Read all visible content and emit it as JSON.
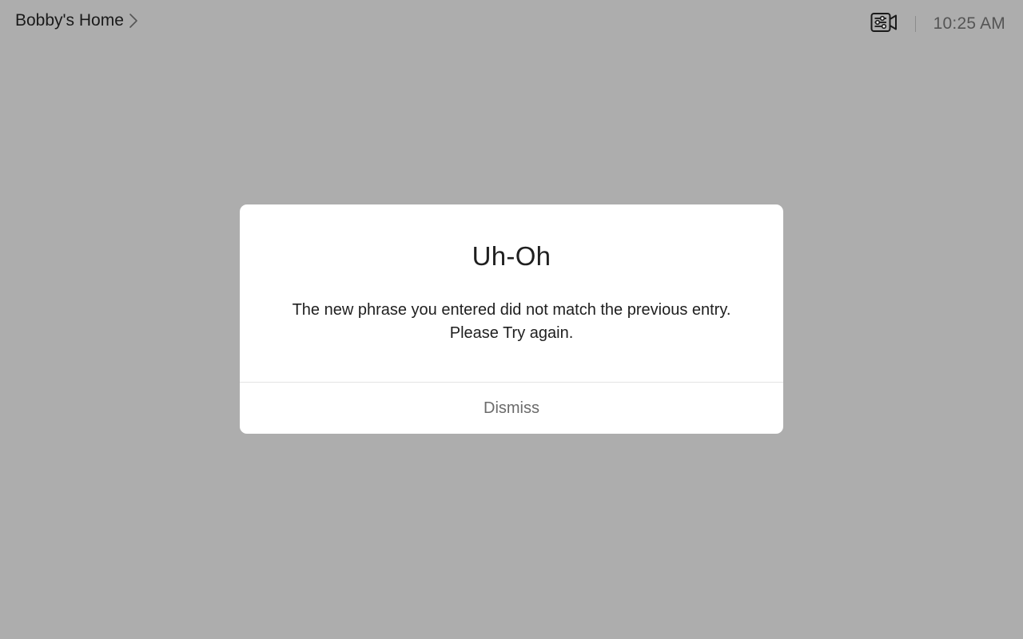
{
  "header": {
    "location_label": "Bobby's Home",
    "chevron_icon": "chevron-right-icon",
    "camera_controls_icon": "camera-controls-icon",
    "time": "10:25 AM"
  },
  "dialog": {
    "title": "Uh-Oh",
    "message": "The new phrase you entered did not match the previous entry. Please Try again.",
    "dismiss_label": "Dismiss"
  },
  "colors": {
    "backdrop": "#adadad",
    "dialog_bg": "#ffffff",
    "text_primary": "#1f1f1f",
    "text_secondary": "#6b6b6b"
  }
}
